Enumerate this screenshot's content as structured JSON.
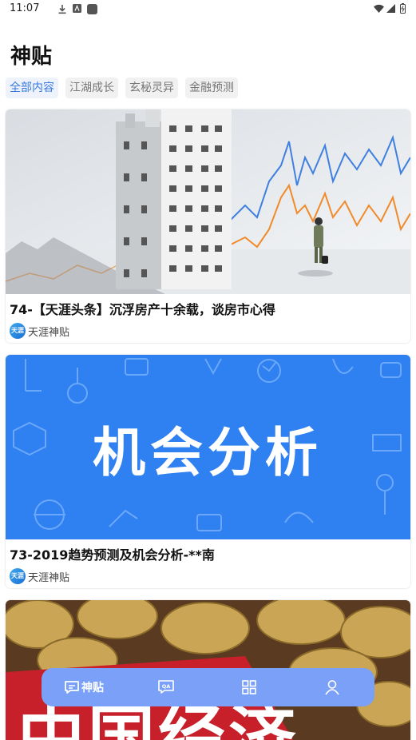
{
  "status": {
    "time": "11:07"
  },
  "header": {
    "title": "神贴"
  },
  "tabs": [
    {
      "label": "全部内容",
      "active": true
    },
    {
      "label": "江湖成长",
      "active": false
    },
    {
      "label": "玄秘灵异",
      "active": false
    },
    {
      "label": "金融预测",
      "active": false
    }
  ],
  "posts": [
    {
      "title": "74-【天涯头条】沉浮房产十余载，谈房市心得",
      "source": "天涯神贴",
      "logo_text": "天涯"
    },
    {
      "title": "73-2019趋势预测及机会分析-**南",
      "source": "天涯神贴",
      "logo_text": "天涯",
      "image_text": "机会分析"
    },
    {
      "image_text": "中国经济"
    }
  ],
  "nav": {
    "items": [
      {
        "label": "神贴",
        "icon": "chat-icon",
        "active": true
      },
      {
        "label": "",
        "icon": "qa-icon"
      },
      {
        "label": "",
        "icon": "grid-icon"
      },
      {
        "label": "",
        "icon": "person-icon"
      }
    ]
  },
  "colors": {
    "accent": "#3b7be0",
    "nav_bg": "#7aa0f7",
    "card2_bg": "#2f80f0",
    "card3_red": "#c8202a"
  }
}
